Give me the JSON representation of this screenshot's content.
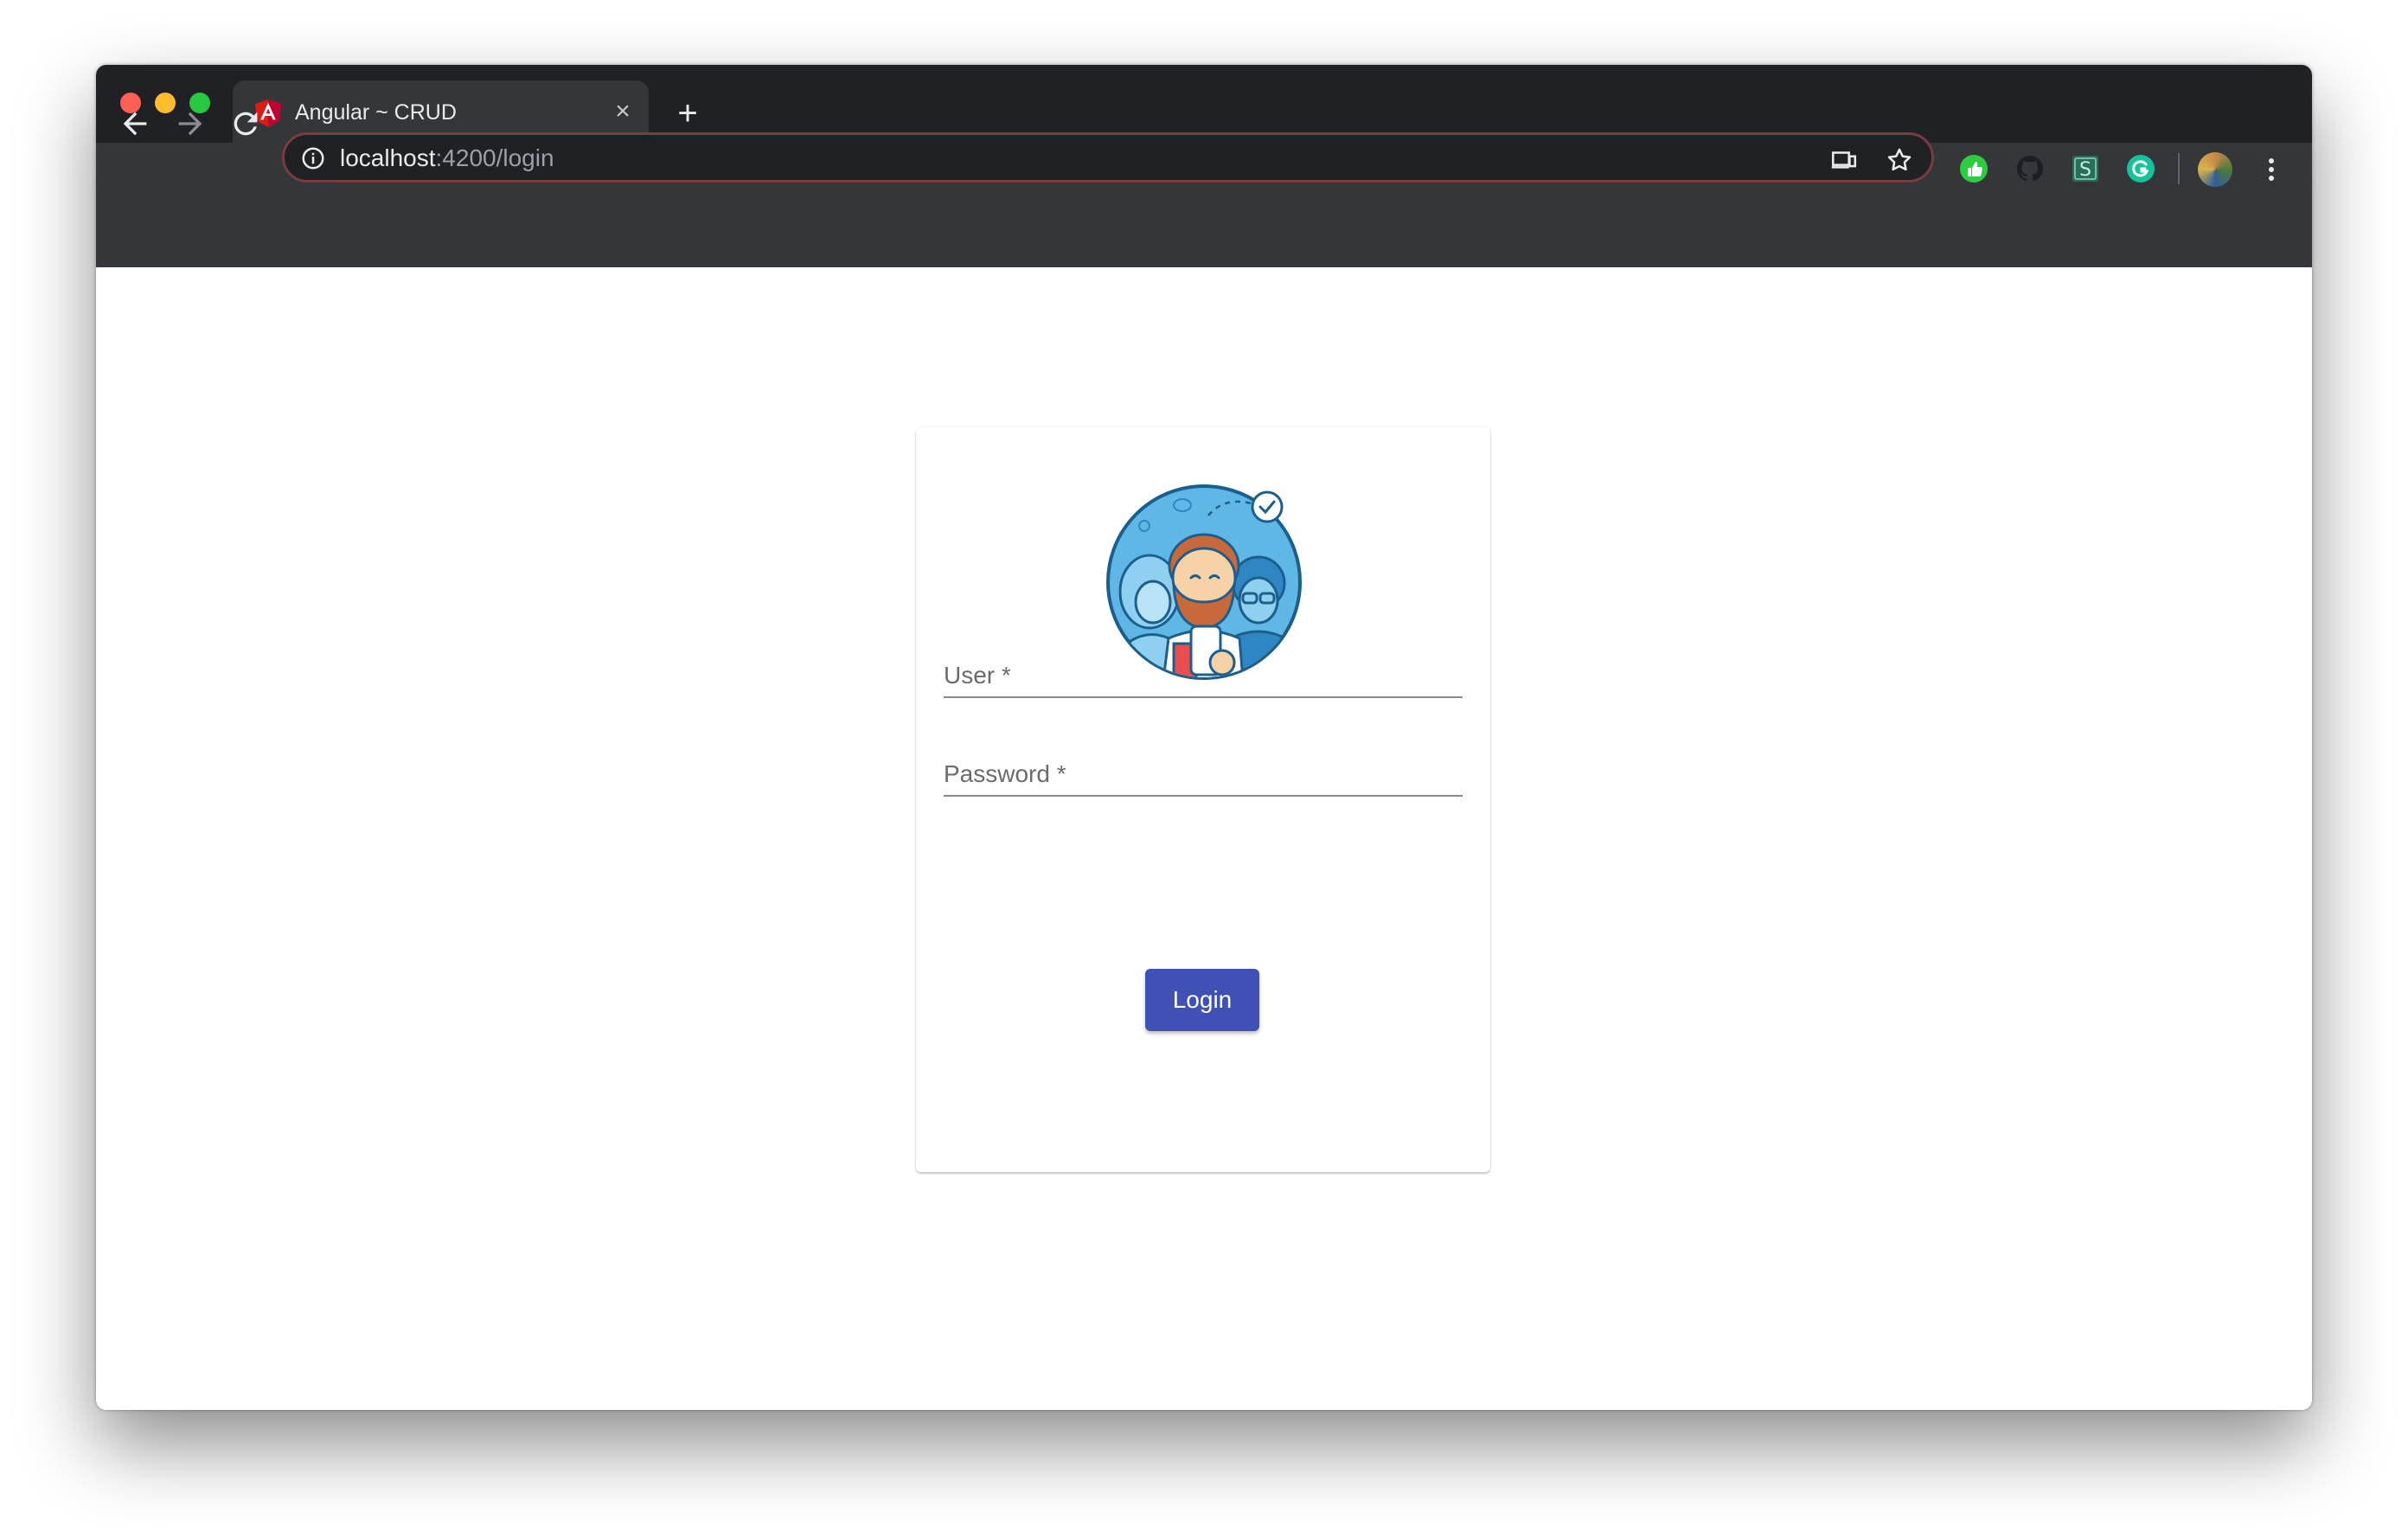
{
  "browser": {
    "tab": {
      "title": "Angular ~ CRUD",
      "icon": "angular-icon"
    },
    "url": {
      "host": "localhost",
      "path": ":4200/login"
    },
    "colors": {
      "accent": "#3f51b5",
      "frame": "#202124",
      "toolbar": "#35363a"
    },
    "extensions": [
      "thumbs-up-extension-icon",
      "github-extension-icon",
      "s-extension-icon",
      "grammarly-extension-icon"
    ]
  },
  "login": {
    "user_label": "User *",
    "password_label": "Password *",
    "submit_label": "Login",
    "logo": "team-illustration"
  }
}
